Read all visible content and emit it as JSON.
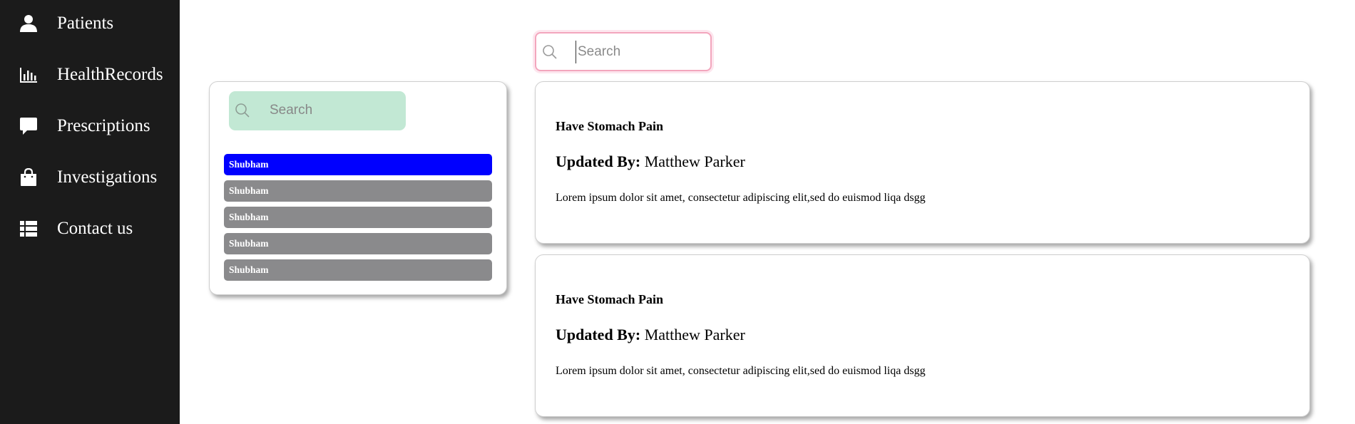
{
  "sidebar": {
    "items": [
      {
        "label": "Patients",
        "icon": "user-icon"
      },
      {
        "label": "HealthRecords",
        "icon": "bar-chart-icon"
      },
      {
        "label": "Prescriptions",
        "icon": "chat-bubble-icon"
      },
      {
        "label": "Investigations",
        "icon": "shopping-bag-icon"
      },
      {
        "label": "Contact us",
        "icon": "table-list-icon"
      }
    ]
  },
  "top_search": {
    "placeholder": "Search"
  },
  "left_panel": {
    "search_placeholder": "Search",
    "users": [
      {
        "name": "Shubham",
        "active": true
      },
      {
        "name": "Shubham",
        "active": false
      },
      {
        "name": "Shubham",
        "active": false
      },
      {
        "name": "Shubham",
        "active": false
      },
      {
        "name": "Shubham",
        "active": false
      }
    ]
  },
  "records": [
    {
      "title": "Have Stomach Pain",
      "updated_label": "Updated By:",
      "updated_by": "Matthew Parker",
      "description": "Lorem ipsum dolor sit amet, consectetur adipiscing elit,sed do euismod liqa dsgg"
    },
    {
      "title": "Have Stomach Pain",
      "updated_label": "Updated By:",
      "updated_by": "Matthew Parker",
      "description": "Lorem ipsum dolor sit amet, consectetur adipiscing elit,sed do euismod liqa dsgg"
    }
  ],
  "colors": {
    "sidebar_bg": "#1b1b1b",
    "active_user": "#0000ff",
    "inactive_user": "#8a8a8c",
    "panel_search_bg": "#c2e8d4",
    "top_search_border": "#f3a6bd"
  }
}
